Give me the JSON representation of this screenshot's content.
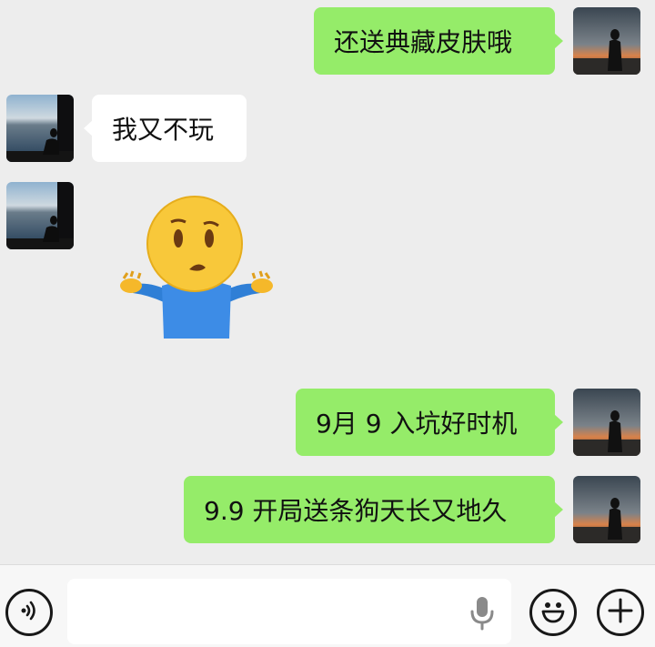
{
  "messages": [
    {
      "side": "right",
      "text": "还送典藏皮肤哦"
    },
    {
      "side": "left",
      "text": "我又不玩"
    },
    {
      "side": "left",
      "sticker": "shrugging-person-emoji"
    },
    {
      "side": "right",
      "text": "9月 9 入坑好时机"
    },
    {
      "side": "right",
      "text": "9.9 开局送条狗天长又地久"
    }
  ],
  "input": {
    "value": "",
    "placeholder": ""
  },
  "icons": {
    "voice": "voice-mode-icon",
    "mic": "microphone-icon",
    "emoji": "emoji-icon",
    "more": "plus-icon"
  },
  "colors": {
    "my_bubble": "#95ec69",
    "their_bubble": "#ffffff",
    "background": "#ededed"
  }
}
